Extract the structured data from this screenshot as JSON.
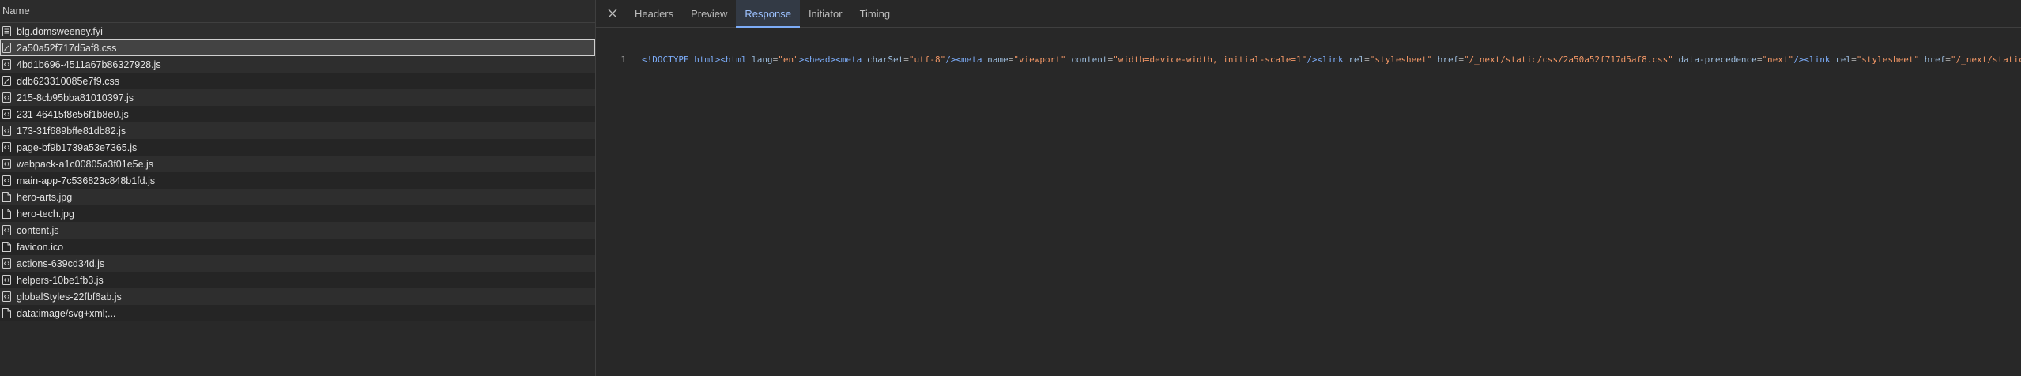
{
  "requests": {
    "header": "Name",
    "items": [
      {
        "name": "blg.domsweeney.fyi",
        "icon": "document-icon",
        "selected": false
      },
      {
        "name": "2a50a52f717d5af8.css",
        "icon": "stylesheet-icon",
        "selected": true
      },
      {
        "name": "4bd1b696-4511a67b86327928.js",
        "icon": "script-icon",
        "selected": false
      },
      {
        "name": "ddb623310085e7f9.css",
        "icon": "stylesheet-icon",
        "selected": false
      },
      {
        "name": "215-8cb95bba81010397.js",
        "icon": "script-icon",
        "selected": false
      },
      {
        "name": "231-46415f8e56f1b8e0.js",
        "icon": "script-icon",
        "selected": false
      },
      {
        "name": "173-31f689bffe81db82.js",
        "icon": "script-icon",
        "selected": false
      },
      {
        "name": "page-bf9b1739a53e7365.js",
        "icon": "script-icon",
        "selected": false
      },
      {
        "name": "webpack-a1c00805a3f01e5e.js",
        "icon": "script-icon",
        "selected": false
      },
      {
        "name": "main-app-7c536823c848b1fd.js",
        "icon": "script-icon",
        "selected": false
      },
      {
        "name": "hero-arts.jpg",
        "icon": "file-icon",
        "selected": false
      },
      {
        "name": "hero-tech.jpg",
        "icon": "file-icon",
        "selected": false
      },
      {
        "name": "content.js",
        "icon": "script-icon",
        "selected": false
      },
      {
        "name": "favicon.ico",
        "icon": "file-icon",
        "selected": false
      },
      {
        "name": "actions-639cd34d.js",
        "icon": "script-icon",
        "selected": false
      },
      {
        "name": "helpers-10be1fb3.js",
        "icon": "script-icon",
        "selected": false
      },
      {
        "name": "globalStyles-22fbf6ab.js",
        "icon": "script-icon",
        "selected": false
      },
      {
        "name": "data:image/svg+xml;...",
        "icon": "file-icon",
        "selected": false
      }
    ]
  },
  "details": {
    "close_icon": "close-icon",
    "tabs": [
      {
        "label": "Headers",
        "active": false
      },
      {
        "label": "Preview",
        "active": false
      },
      {
        "label": "Response",
        "active": true
      },
      {
        "label": "Initiator",
        "active": false
      },
      {
        "label": "Timing",
        "active": false
      }
    ],
    "response": {
      "line_number": "1",
      "tokens": [
        {
          "t": "<!DOCTYPE html>",
          "c": "tag"
        },
        {
          "t": "<html",
          "c": "tag"
        },
        {
          "t": " lang",
          "c": "attr"
        },
        {
          "t": "=",
          "c": "punct"
        },
        {
          "t": "\"en\"",
          "c": "val"
        },
        {
          "t": ">",
          "c": "tag"
        },
        {
          "t": "<head>",
          "c": "tag"
        },
        {
          "t": "<meta",
          "c": "tag"
        },
        {
          "t": " charSet",
          "c": "attr"
        },
        {
          "t": "=",
          "c": "punct"
        },
        {
          "t": "\"utf-8\"",
          "c": "val"
        },
        {
          "t": "/>",
          "c": "tag"
        },
        {
          "t": "<meta",
          "c": "tag"
        },
        {
          "t": " name",
          "c": "attr"
        },
        {
          "t": "=",
          "c": "punct"
        },
        {
          "t": "\"viewport\"",
          "c": "val"
        },
        {
          "t": " content",
          "c": "attr"
        },
        {
          "t": "=",
          "c": "punct"
        },
        {
          "t": "\"width=device-width, initial-scale=1\"",
          "c": "val"
        },
        {
          "t": "/>",
          "c": "tag"
        },
        {
          "t": "<link",
          "c": "tag"
        },
        {
          "t": " rel",
          "c": "attr"
        },
        {
          "t": "=",
          "c": "punct"
        },
        {
          "t": "\"stylesheet\"",
          "c": "val"
        },
        {
          "t": " href",
          "c": "attr"
        },
        {
          "t": "=",
          "c": "punct"
        },
        {
          "t": "\"/_next/static/css/2a50a52f717d5af8.css\"",
          "c": "val"
        },
        {
          "t": " data-precedence",
          "c": "attr"
        },
        {
          "t": "=",
          "c": "punct"
        },
        {
          "t": "\"next\"",
          "c": "val"
        },
        {
          "t": "/>",
          "c": "tag"
        },
        {
          "t": "<link",
          "c": "tag"
        },
        {
          "t": " rel",
          "c": "attr"
        },
        {
          "t": "=",
          "c": "punct"
        },
        {
          "t": "\"stylesheet\"",
          "c": "val"
        },
        {
          "t": " href",
          "c": "attr"
        },
        {
          "t": "=",
          "c": "punct"
        },
        {
          "t": "\"/_next/static/",
          "c": "val"
        }
      ]
    }
  }
}
